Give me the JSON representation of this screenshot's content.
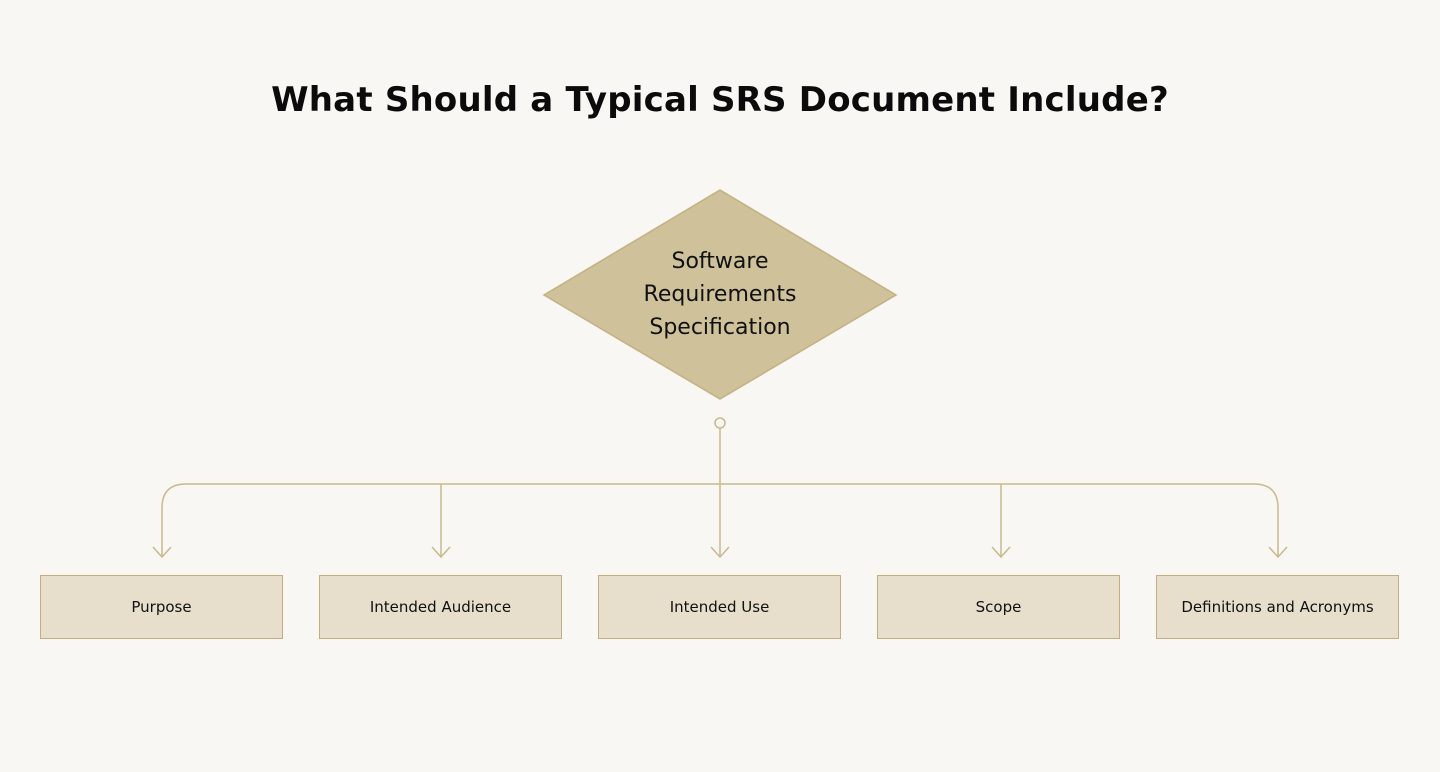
{
  "title": "What Should a Typical SRS Document Include?",
  "root": {
    "label": "Software\nRequirements\nSpecification"
  },
  "children": [
    {
      "label": "Purpose"
    },
    {
      "label": "Intended Audience"
    },
    {
      "label": "Intended Use"
    },
    {
      "label": "Scope"
    },
    {
      "label": "Definitions and Acronyms"
    }
  ],
  "colors": {
    "background": "#f8f7f3",
    "diamond_fill": "#cfc199",
    "connector": "#c9b98c",
    "box_fill": "#e7dfcb",
    "box_border": "#c3ae80"
  }
}
